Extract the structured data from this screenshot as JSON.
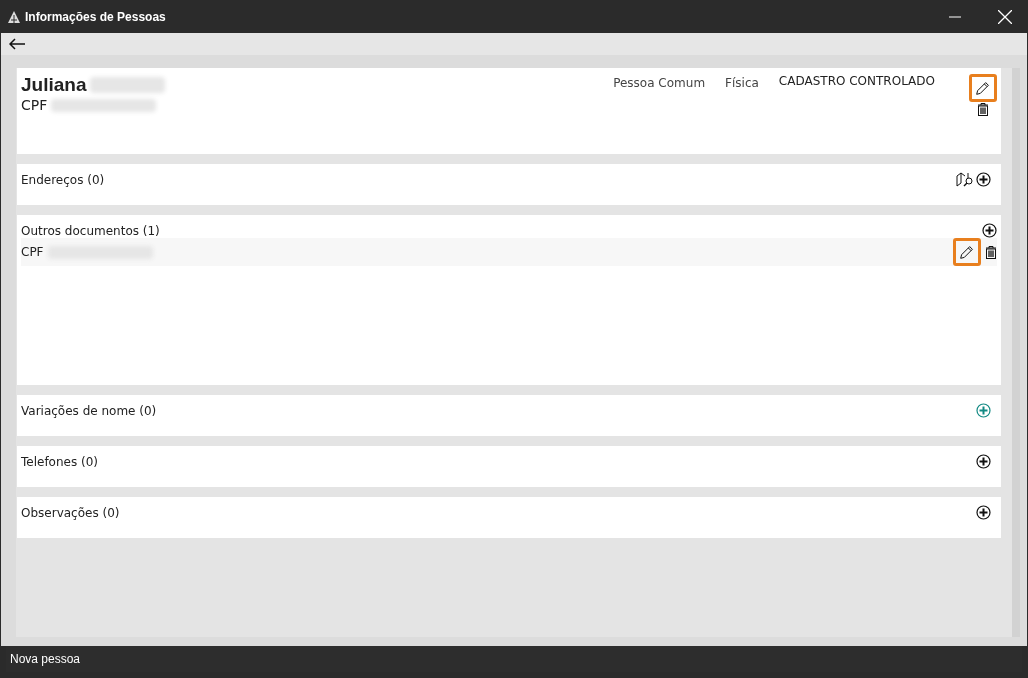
{
  "window": {
    "title": "Informações de Pessoas"
  },
  "person": {
    "first_name": "Juliana",
    "document_label": "CPF",
    "type": "Pessoa Comum",
    "nature": "Física",
    "status": "CADASTRO CONTROLADO",
    "edit_highlighted": true
  },
  "sections": [
    {
      "title": "Endereços (0)",
      "actions": [
        {
          "kind": "map"
        },
        {
          "kind": "add",
          "highlighted": false
        }
      ]
    },
    {
      "title": "Outros documentos (1)",
      "actions": [
        {
          "kind": "add",
          "highlighted": false
        }
      ],
      "rows": [
        {
          "label": "CPF",
          "edit_highlighted": true
        }
      ]
    },
    {
      "title": "Variações de nome (0)",
      "actions": [
        {
          "kind": "add",
          "highlighted": true
        }
      ]
    },
    {
      "title": "Telefones (0)",
      "actions": [
        {
          "kind": "add",
          "highlighted": false
        }
      ]
    },
    {
      "title": "Observações (0)",
      "actions": [
        {
          "kind": "add",
          "highlighted": false
        }
      ]
    }
  ],
  "status_bar": {
    "text": "Nova pessoa"
  }
}
